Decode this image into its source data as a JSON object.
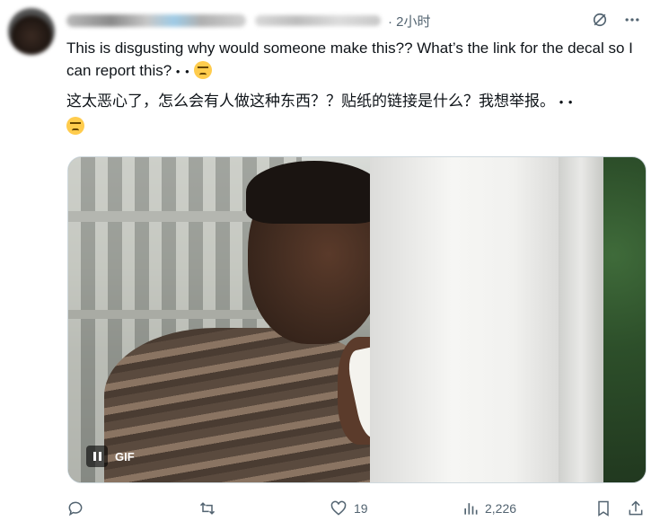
{
  "tweet": {
    "time": "· 2小时",
    "text_en_line": "This is disgusting why would someone make this?? What’s the link for the decal so I can report this?",
    "text_zh_line": "这太恶心了，怎么会有人做这种东西？？贴纸的链接是什么？我想举报。",
    "emoji_dots": "• •"
  },
  "media": {
    "badge_label": "GIF"
  },
  "actions": {
    "reply_count": "",
    "retweet_count": "",
    "like_count": "19",
    "views_count": "2,226"
  },
  "icons": {
    "avatar": "avatar-image",
    "grok": "grok-icon",
    "more": "more-icon",
    "reply": "reply-icon",
    "retweet": "retweet-icon",
    "like": "heart-icon",
    "views": "views-icon",
    "bookmark": "bookmark-icon",
    "share": "share-icon"
  },
  "colors": {
    "text": "#0f1419",
    "muted": "#536471",
    "border": "#cfd9de"
  }
}
